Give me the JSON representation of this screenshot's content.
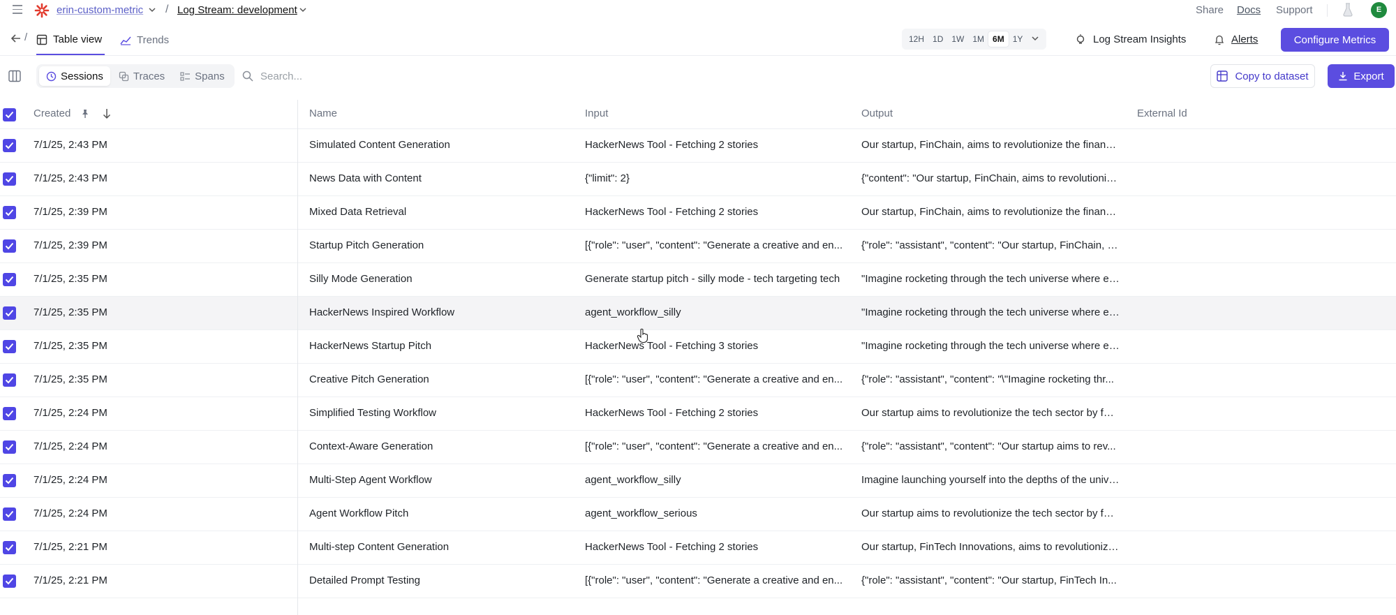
{
  "header": {
    "project": "erin-custom-metric",
    "separator": "/",
    "log_stream": "Log Stream: development",
    "share": "Share",
    "docs": "Docs",
    "support": "Support",
    "avatar_initial": "E"
  },
  "nav": {
    "separator": "/",
    "tabs": [
      {
        "label": "Table view",
        "active": true
      },
      {
        "label": "Trends",
        "active": false
      }
    ],
    "time_ranges": [
      "12H",
      "1D",
      "1W",
      "1M",
      "6M",
      "1Y"
    ],
    "active_range": "6M",
    "insights": "Log Stream Insights",
    "alerts": "Alerts",
    "configure": "Configure Metrics"
  },
  "toolbar": {
    "segments": [
      {
        "label": "Sessions",
        "active": true
      },
      {
        "label": "Traces",
        "active": false
      },
      {
        "label": "Spans",
        "active": false
      }
    ],
    "search_placeholder": "Search...",
    "copy_to_dataset": "Copy to dataset",
    "export": "Export"
  },
  "table": {
    "columns": [
      "Created",
      "Name",
      "Input",
      "Output",
      "External Id"
    ],
    "rows": [
      {
        "created": "7/1/25, 2:43 PM",
        "name": "Simulated Content Generation",
        "input": "HackerNews Tool - Fetching 2 stories",
        "output": "Our startup, FinChain, aims to revolutionize the finance..."
      },
      {
        "created": "7/1/25, 2:43 PM",
        "name": "News Data with Content",
        "input": "{\"limit\": 2}",
        "output": "{\"content\": \"Our startup, FinChain, aims to revolutioniz..."
      },
      {
        "created": "7/1/25, 2:39 PM",
        "name": "Mixed Data Retrieval",
        "input": "HackerNews Tool - Fetching 2 stories",
        "output": "Our startup, FinChain, aims to revolutionize the finance..."
      },
      {
        "created": "7/1/25, 2:39 PM",
        "name": "Startup Pitch Generation",
        "input": "[{\"role\": \"user\", \"content\": \"Generate a creative and en...",
        "output": "{\"role\": \"assistant\", \"content\": \"Our startup, FinChain, a..."
      },
      {
        "created": "7/1/25, 2:35 PM",
        "name": "Silly Mode Generation",
        "input": "Generate startup pitch - silly mode - tech targeting tech",
        "output": "\"Imagine rocketing through the tech universe where ev..."
      },
      {
        "created": "7/1/25, 2:35 PM",
        "name": "HackerNews Inspired Workflow",
        "input": "agent_workflow_silly",
        "output": "\"Imagine rocketing through the tech universe where ev..."
      },
      {
        "created": "7/1/25, 2:35 PM",
        "name": "HackerNews Startup Pitch",
        "input": "HackerNews Tool - Fetching 3 stories",
        "output": "\"Imagine rocketing through the tech universe where ev..."
      },
      {
        "created": "7/1/25, 2:35 PM",
        "name": "Creative Pitch Generation",
        "input": "[{\"role\": \"user\", \"content\": \"Generate a creative and en...",
        "output": "{\"role\": \"assistant\", \"content\": \"\\\"Imagine rocketing thr..."
      },
      {
        "created": "7/1/25, 2:24 PM",
        "name": "Simplified Testing Workflow",
        "input": "HackerNews Tool - Fetching 2 stories",
        "output": "Our startup aims to revolutionize the tech sector by foc..."
      },
      {
        "created": "7/1/25, 2:24 PM",
        "name": "Context-Aware Generation",
        "input": "[{\"role\": \"user\", \"content\": \"Generate a creative and en...",
        "output": "{\"role\": \"assistant\", \"content\": \"Our startup aims to rev..."
      },
      {
        "created": "7/1/25, 2:24 PM",
        "name": "Multi-Step Agent Workflow",
        "input": "agent_workflow_silly",
        "output": "Imagine launching yourself into the depths of the unive..."
      },
      {
        "created": "7/1/25, 2:24 PM",
        "name": "Agent Workflow Pitch",
        "input": "agent_workflow_serious",
        "output": "Our startup aims to revolutionize the tech sector by foc..."
      },
      {
        "created": "7/1/25, 2:21 PM",
        "name": "Multi-step Content Generation",
        "input": "HackerNews Tool - Fetching 2 stories",
        "output": "Our startup, FinTech Innovations, aims to revolutionize ..."
      },
      {
        "created": "7/1/25, 2:21 PM",
        "name": "Detailed Prompt Testing",
        "input": "[{\"role\": \"user\", \"content\": \"Generate a creative and en...",
        "output": "{\"role\": \"assistant\", \"content\": \"Our startup, FinTech In..."
      }
    ]
  },
  "colors": {
    "accent": "#5b4de0",
    "checkbox": "#4f46e5",
    "avatar": "#1f8a3e"
  }
}
